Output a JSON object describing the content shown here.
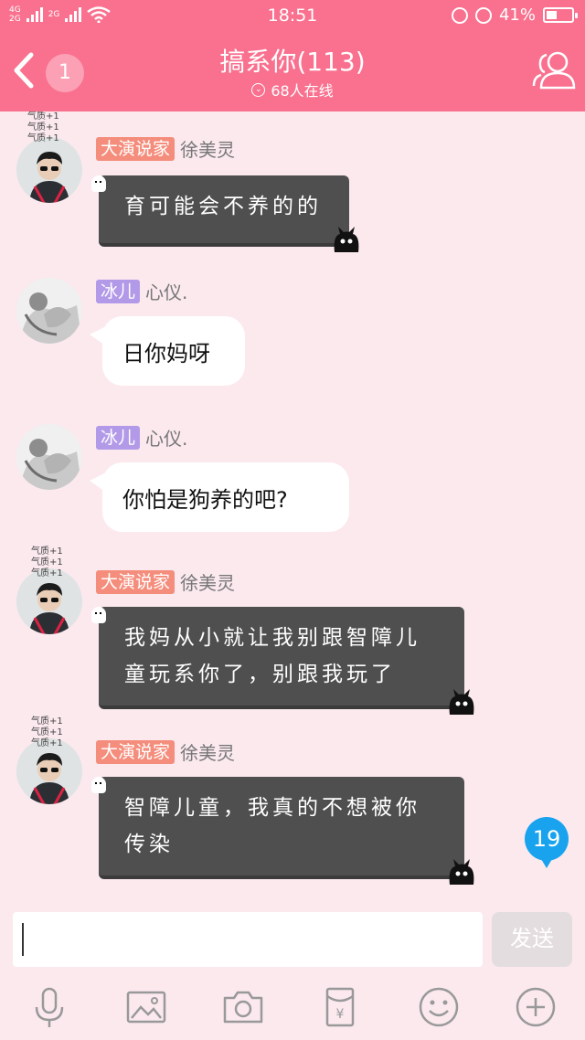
{
  "status_bar": {
    "network_top": "4G",
    "network_bottom": "2G",
    "network_2": "2G",
    "time": "18:51",
    "battery_percent": "41%",
    "battery_level": 0.41
  },
  "header": {
    "unread_count": "1",
    "title": "搞系你(113)",
    "online": "68人在线"
  },
  "messages": [
    {
      "title_tag": "大演说家",
      "tag_color": "#f58d7c",
      "sender": "徐美灵",
      "avatar_tags": [
        "气质+1",
        "气质+1",
        "气质+1"
      ],
      "bubble": "dark",
      "lines": [
        "育可能会不养的的"
      ]
    },
    {
      "title_tag": "冰儿",
      "tag_color": "#b39ae8",
      "sender": "心仪.",
      "bubble": "white",
      "lines": [
        "日你妈呀"
      ]
    },
    {
      "title_tag": "冰儿",
      "tag_color": "#b39ae8",
      "sender": "心仪.",
      "bubble": "white",
      "lines": [
        "你怕是狗养的吧?"
      ]
    },
    {
      "title_tag": "大演说家",
      "tag_color": "#f58d7c",
      "sender": "徐美灵",
      "avatar_tags": [
        "气质+1",
        "气质+1",
        "气质+1"
      ],
      "bubble": "dark",
      "lines": [
        "我妈从小就让我别跟智障儿",
        "童玩系你了，别跟我玩了"
      ]
    },
    {
      "title_tag": "大演说家",
      "tag_color": "#f58d7c",
      "sender": "徐美灵",
      "avatar_tags": [
        "气质+1",
        "气质+1",
        "气质+1"
      ],
      "bubble": "dark",
      "lines": [
        "智障儿童，我真的不想被你",
        "传染"
      ]
    }
  ],
  "floating_unread": "19",
  "composer": {
    "input_value": "",
    "send_label": "发送"
  },
  "toolbar_icons": [
    "microphone-icon",
    "image-icon",
    "camera-icon",
    "red-packet-icon",
    "emoji-icon",
    "plus-icon"
  ],
  "colors": {
    "header_pink": "#f9718f",
    "chat_background": "#fbe9ee",
    "dark_bubble": "#4f4f4f",
    "badge_blue": "#19a3ee"
  }
}
